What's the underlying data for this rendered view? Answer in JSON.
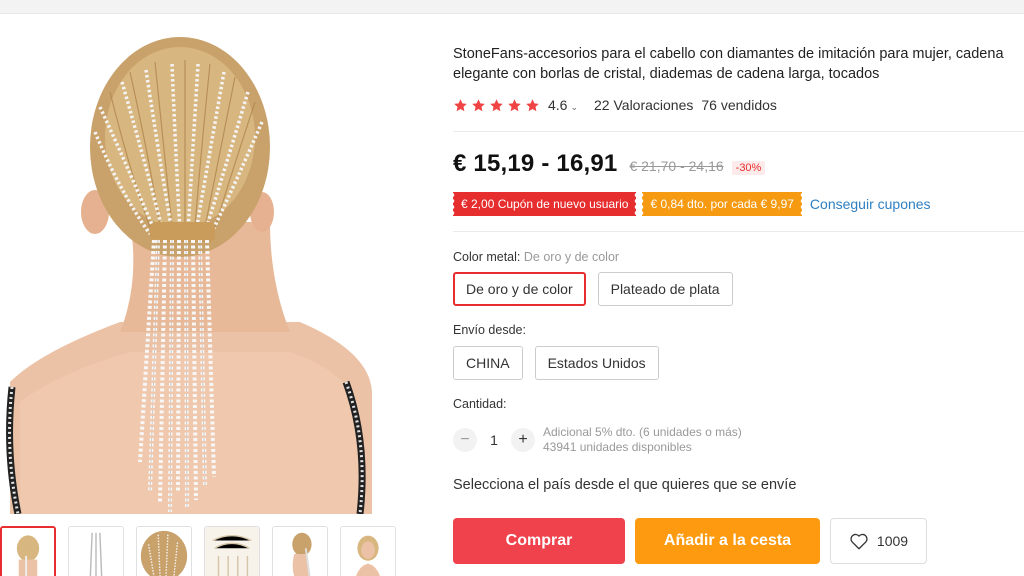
{
  "product": {
    "title": "StoneFans-accesorios para el cabello con diamantes de imitación para mujer, cadena elegante con borlas de cristal, diademas de cadena larga, tocados",
    "rating": "4.6",
    "reviews": "22 Valoraciones",
    "sold": "76 vendidos",
    "stars": 5
  },
  "price": {
    "current": "€ 15,19 - 16,91",
    "original": "€ 21,70 - 24,16",
    "discount": "-30%"
  },
  "coupons": {
    "new_user": "€ 2,00 Cupón de nuevo usuario",
    "store": "€ 0,84 dto. por cada € 9,97",
    "link": "Conseguir cupones"
  },
  "color": {
    "label": "Color metal:",
    "selected_value": "De oro y de color",
    "options": [
      "De oro y de color",
      "Plateado de plata"
    ]
  },
  "shipping": {
    "label": "Envío desde:",
    "options": [
      "CHINA",
      "Estados Unidos"
    ],
    "note": "Selecciona el país desde el que quieres que se envíe"
  },
  "quantity": {
    "label": "Cantidad:",
    "value": "1",
    "minus": "−",
    "plus": "+",
    "extra_discount": "Adicional 5% dto. (6 unidades o más)",
    "available": "43941 unidades disponibles"
  },
  "actions": {
    "buy": "Comprar",
    "cart": "Añadir a la cesta",
    "wishlist_count": "1009"
  },
  "colors": {
    "accent_red": "#e62e2e",
    "buy_button": "#f0424c",
    "cart_button": "#fe9a10",
    "link_blue": "#2f7fc1",
    "star": "#f04444"
  }
}
